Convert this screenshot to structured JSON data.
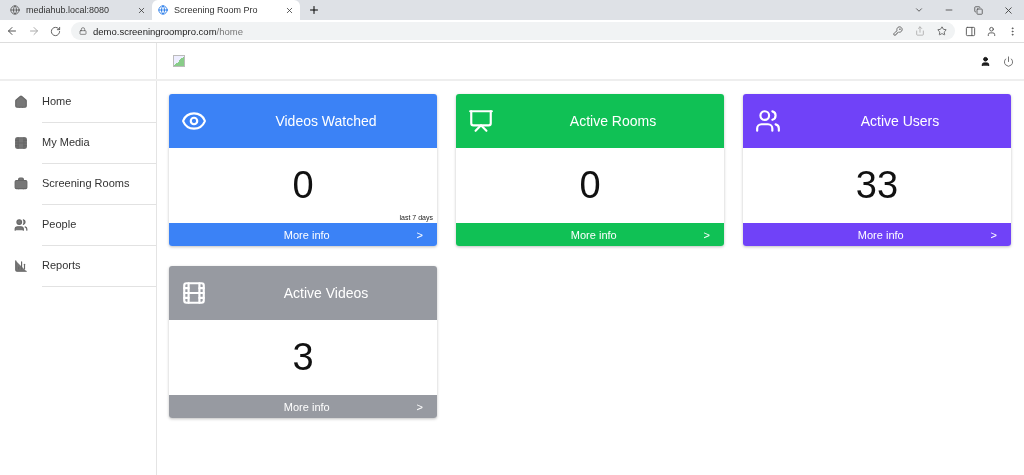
{
  "browser": {
    "tabs": [
      {
        "title": "mediahub.local:8080",
        "selected": false
      },
      {
        "title": "Screening Room Pro",
        "selected": true
      }
    ],
    "url": {
      "host": "demo.screeningroompro.com",
      "path": "/home"
    }
  },
  "sidebar": {
    "items": [
      {
        "label": "Home"
      },
      {
        "label": "My Media"
      },
      {
        "label": "Screening Rooms"
      },
      {
        "label": "People"
      },
      {
        "label": "Reports"
      }
    ]
  },
  "cards": [
    {
      "title": "Videos Watched",
      "color": "#3b82f6",
      "value": "0",
      "note": "last 7 days",
      "footer": "More info",
      "arrow": ">"
    },
    {
      "title": "Active Rooms",
      "color": "#10c155",
      "value": "0",
      "footer": "More info",
      "arrow": ">"
    },
    {
      "title": "Active Users",
      "color": "#7042f8",
      "value": "33",
      "footer": "More info",
      "arrow": ">"
    },
    {
      "title": "Active Videos",
      "color": "#979aa1",
      "value": "3",
      "footer": "More info",
      "arrow": ">"
    }
  ]
}
